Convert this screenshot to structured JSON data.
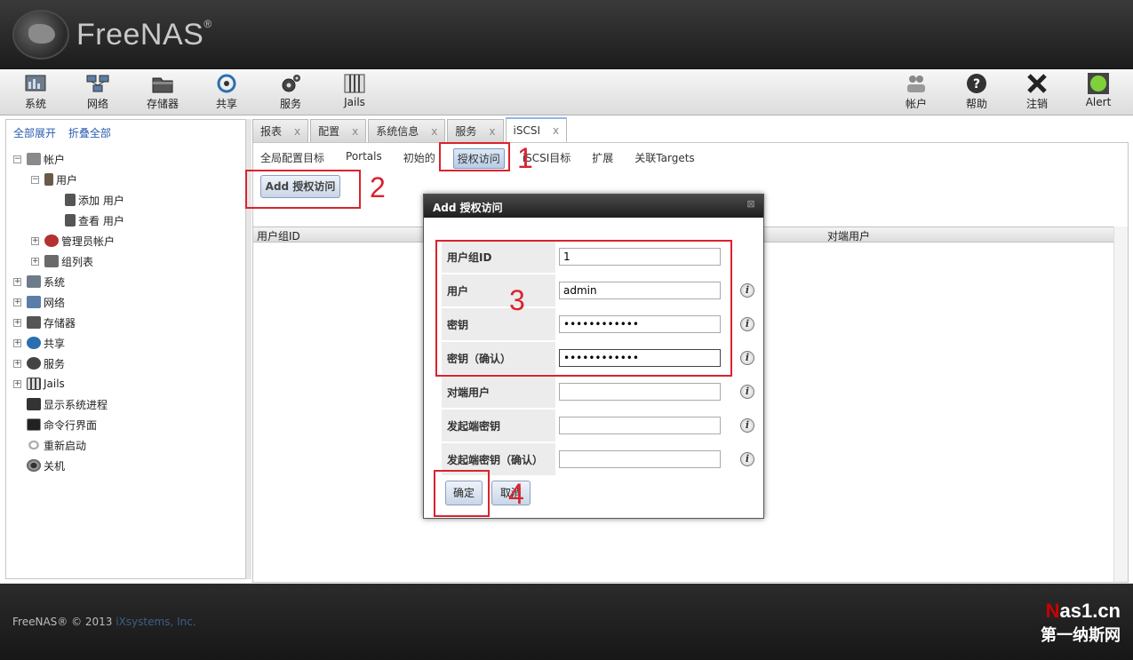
{
  "header": {
    "brand": "FreeNAS",
    "brand_mark": "®"
  },
  "toolbar": {
    "left": [
      {
        "label": "系统",
        "icon": "system-icon"
      },
      {
        "label": "网络",
        "icon": "network-icon"
      },
      {
        "label": "存储器",
        "icon": "storage-icon"
      },
      {
        "label": "共享",
        "icon": "sharing-icon"
      },
      {
        "label": "服务",
        "icon": "services-icon"
      },
      {
        "label": "Jails",
        "icon": "jails-icon"
      }
    ],
    "right": [
      {
        "label": "帐户",
        "icon": "account-icon"
      },
      {
        "label": "帮助",
        "icon": "help-icon"
      },
      {
        "label": "注销",
        "icon": "logout-icon"
      },
      {
        "label": "Alert",
        "icon": "alert-icon"
      }
    ]
  },
  "sidebar": {
    "expand_all": "全部展开",
    "collapse_all": "折叠全部",
    "tree": [
      {
        "label": "帐户",
        "toggle": "−"
      },
      {
        "label": "用户",
        "toggle": "−"
      },
      {
        "label": "添加 用户"
      },
      {
        "label": "查看 用户"
      },
      {
        "label": "管理员帐户",
        "toggle": "+"
      },
      {
        "label": "组列表",
        "toggle": "+"
      },
      {
        "label": "系统",
        "toggle": "+"
      },
      {
        "label": "网络",
        "toggle": "+"
      },
      {
        "label": "存储器",
        "toggle": "+"
      },
      {
        "label": "共享",
        "toggle": "+"
      },
      {
        "label": "服务",
        "toggle": "+"
      },
      {
        "label": "Jails",
        "toggle": "+"
      },
      {
        "label": "显示系统进程"
      },
      {
        "label": "命令行界面"
      },
      {
        "label": "重新启动"
      },
      {
        "label": "关机"
      }
    ]
  },
  "tabs": [
    {
      "label": "报表",
      "close": "x"
    },
    {
      "label": "配置",
      "close": "x"
    },
    {
      "label": "系统信息",
      "close": "x"
    },
    {
      "label": "服务",
      "close": "x"
    },
    {
      "label": "iSCSI",
      "close": "x"
    }
  ],
  "subtabs": [
    "全局配置目标",
    "Portals",
    "初始的",
    "授权访问",
    "iSCSI目标",
    "扩展",
    "关联Targets"
  ],
  "add_button": "Add 授权访问",
  "grid": {
    "columns": [
      "用户组ID",
      "对端用户"
    ]
  },
  "dialog": {
    "title": "Add 授权访问",
    "close": "⊠",
    "fields": [
      {
        "label": "用户组ID",
        "value": "1"
      },
      {
        "label": "用户",
        "value": "admin"
      },
      {
        "label": "密钥",
        "value": "••••••••••••"
      },
      {
        "label": "密钥（确认）",
        "value": "••••••••••••"
      },
      {
        "label": "对端用户",
        "value": ""
      },
      {
        "label": "发起端密钥",
        "value": ""
      },
      {
        "label": "发起端密钥（确认）",
        "value": ""
      }
    ],
    "info_glyph": "i",
    "ok": "确定",
    "cancel": "取消"
  },
  "annotations": [
    "1",
    "2",
    "3",
    "4"
  ],
  "annotation_color": "#d9232e",
  "footer": {
    "text": "FreeNAS® © 2013 ",
    "link": "iXsystems, Inc."
  },
  "watermark": {
    "line1_red": "N",
    "line1_rest": "as1.cn",
    "line2": "第一纳斯网"
  }
}
